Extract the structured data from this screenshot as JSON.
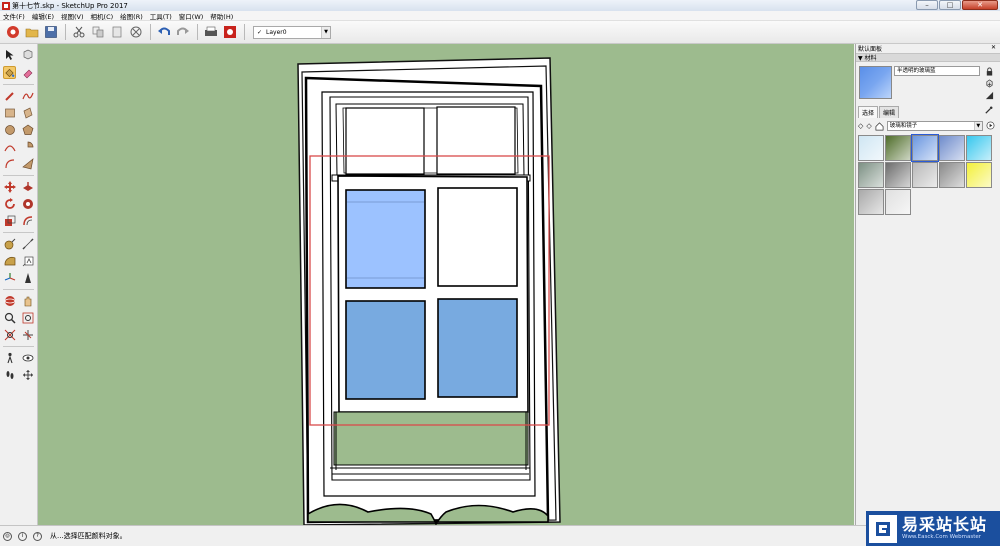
{
  "window": {
    "title": "第十七节.skp - SketchUp Pro 2017",
    "minimize": "–",
    "maximize": "□",
    "close": "✕"
  },
  "menu": [
    "文件(F)",
    "编辑(E)",
    "视图(V)",
    "相机(C)",
    "绘图(R)",
    "工具(T)",
    "窗口(W)",
    "帮助(H)"
  ],
  "toolbar": {
    "layer_check": "✓",
    "layer_name": "Layer0",
    "dropdown_arrow": "▼"
  },
  "panel": {
    "title": "默认面板",
    "close": "✕",
    "section": "▼ 材料",
    "material_name": "半透明的玻璃蓝",
    "tabs": [
      "选择",
      "编辑"
    ],
    "nav_back": "◇",
    "nav_forward": "◇",
    "collection": "玻璃和镜子",
    "collection_arrow": "▼",
    "swatches": [
      "#cfe6f3",
      "#4f6d2a",
      "#6b97e0",
      "#6f8ccc",
      "#36c7ee",
      "#7d9184",
      "#6d6d6d",
      "#b9b9b9",
      "#8a8a8a",
      "#f3f03a",
      "#a9a9a9",
      "#e0e0e0"
    ]
  },
  "status": {
    "text": "从...选择匹配颜料对象。"
  },
  "watermark": {
    "main": "易采站长站",
    "sub": "Www.Easck.Com Webmaster"
  }
}
